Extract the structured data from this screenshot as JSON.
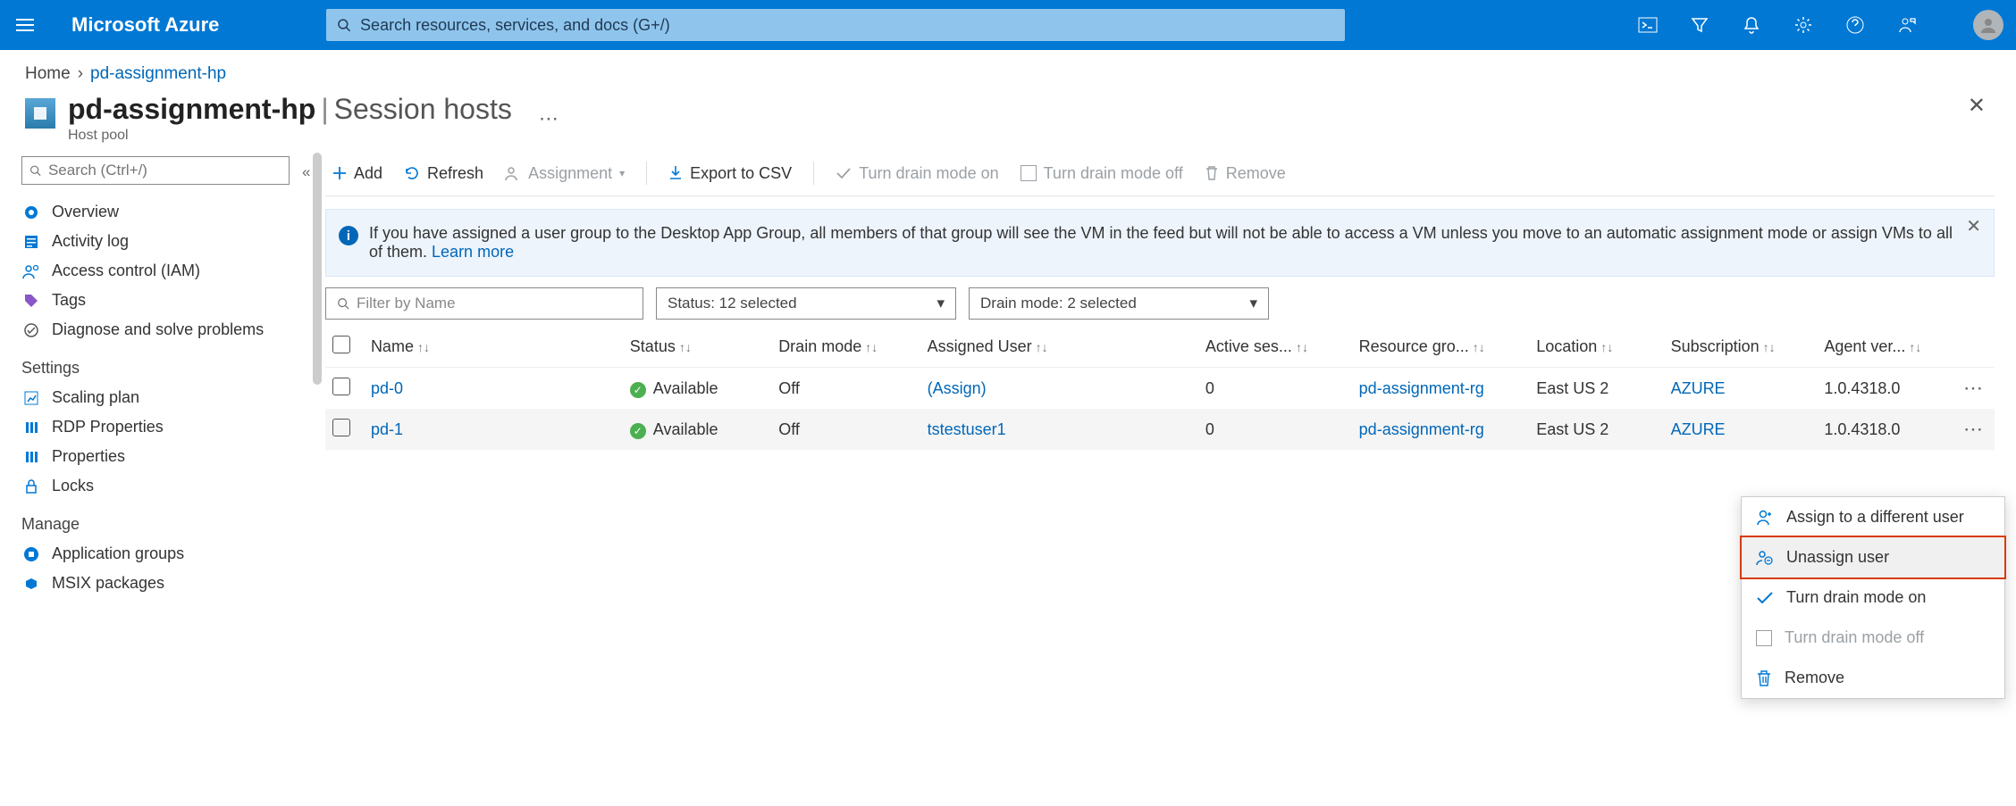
{
  "header": {
    "brand": "Microsoft Azure",
    "search_placeholder": "Search resources, services, and docs (G+/)"
  },
  "breadcrumb": {
    "home": "Home",
    "current": "pd-assignment-hp"
  },
  "page": {
    "title": "pd-assignment-hp",
    "section": "Session hosts",
    "subtitle": "Host pool"
  },
  "sidebar": {
    "search_placeholder": "Search (Ctrl+/)",
    "top": [
      {
        "label": "Overview",
        "icon": "overview-icon"
      },
      {
        "label": "Activity log",
        "icon": "activitylog-icon"
      },
      {
        "label": "Access control (IAM)",
        "icon": "iam-icon"
      },
      {
        "label": "Tags",
        "icon": "tags-icon"
      },
      {
        "label": "Diagnose and solve problems",
        "icon": "diagnose-icon"
      }
    ],
    "settings_header": "Settings",
    "settings": [
      {
        "label": "Scaling plan",
        "icon": "scaling-icon"
      },
      {
        "label": "RDP Properties",
        "icon": "rdp-icon"
      },
      {
        "label": "Properties",
        "icon": "properties-icon"
      },
      {
        "label": "Locks",
        "icon": "locks-icon"
      }
    ],
    "manage_header": "Manage",
    "manage": [
      {
        "label": "Application groups",
        "icon": "appgroups-icon"
      },
      {
        "label": "MSIX packages",
        "icon": "msix-icon"
      }
    ]
  },
  "toolbar": {
    "add": "Add",
    "refresh": "Refresh",
    "assignment": "Assignment",
    "export": "Export to CSV",
    "drain_on": "Turn drain mode on",
    "drain_off": "Turn drain mode off",
    "remove": "Remove"
  },
  "infobar": {
    "text": "If you have assigned a user group to the Desktop App Group, all members of that group will see the VM in the feed but will not be able to access a VM unless you move to an automatic assignment mode or assign VMs to all of them. ",
    "learnmore": "Learn more"
  },
  "filters": {
    "name_placeholder": "Filter by Name",
    "status": "Status: 12 selected",
    "drain": "Drain mode: 2 selected"
  },
  "columns": {
    "name": "Name",
    "status": "Status",
    "drain": "Drain mode",
    "assigned": "Assigned User",
    "active": "Active ses...",
    "rg": "Resource gro...",
    "location": "Location",
    "subscription": "Subscription",
    "agent": "Agent ver..."
  },
  "rows": [
    {
      "name": "pd-0",
      "status": "Available",
      "drain": "Off",
      "assigned": "(Assign)",
      "active": "0",
      "rg": "pd-assignment-rg",
      "location": "East US 2",
      "subscription": "AZURE",
      "agent": "1.0.4318.0"
    },
    {
      "name": "pd-1",
      "status": "Available",
      "drain": "Off",
      "assigned": "tstestuser1",
      "active": "0",
      "rg": "pd-assignment-rg",
      "location": "East US 2",
      "subscription": "AZURE",
      "agent": "1.0.4318.0"
    }
  ],
  "context_menu": {
    "assign": "Assign to a different user",
    "unassign": "Unassign user",
    "drain_on": "Turn drain mode on",
    "drain_off": "Turn drain mode off",
    "remove": "Remove"
  }
}
